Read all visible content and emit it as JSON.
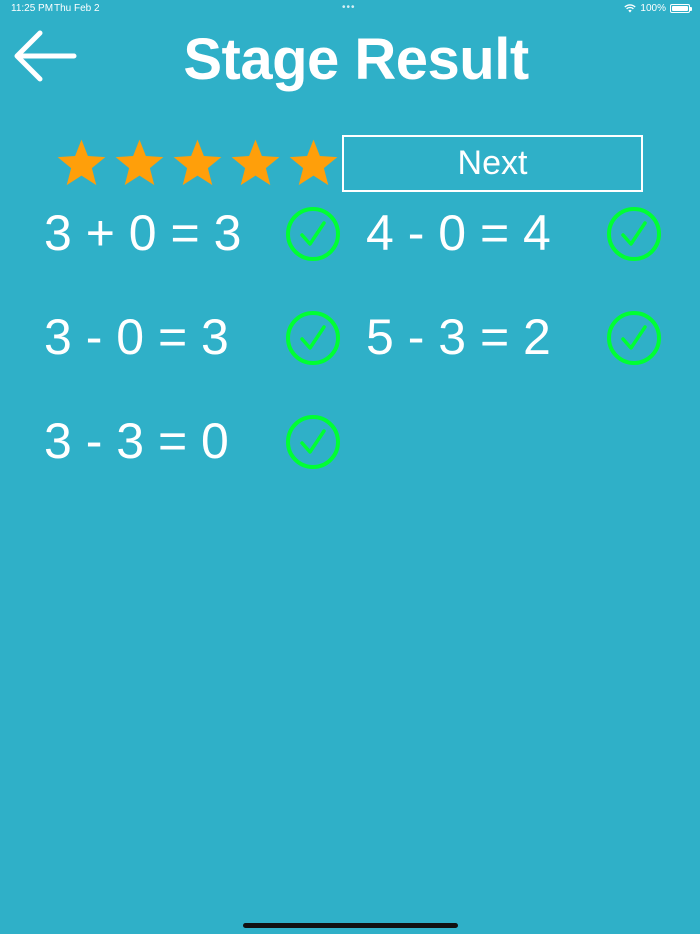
{
  "status_bar": {
    "time": "11:25 PM",
    "date": "Thu Feb 2",
    "battery": "100%"
  },
  "header": {
    "title": "Stage Result",
    "back_icon": "arrow-left-icon"
  },
  "rating": {
    "stars": 5,
    "max_stars": 5,
    "star_color": "#ff9f0a"
  },
  "next_button": {
    "label": "Next"
  },
  "results": [
    {
      "equation": "3 + 0 = 3",
      "correct": true
    },
    {
      "equation": "4 - 0 = 4",
      "correct": true
    },
    {
      "equation": "3 - 0 = 3",
      "correct": true
    },
    {
      "equation": "5 - 3 = 2",
      "correct": true
    },
    {
      "equation": "3 - 3 = 0",
      "correct": true
    }
  ],
  "colors": {
    "background": "#2fb0c8",
    "check": "#00ff33",
    "text": "#ffffff"
  }
}
